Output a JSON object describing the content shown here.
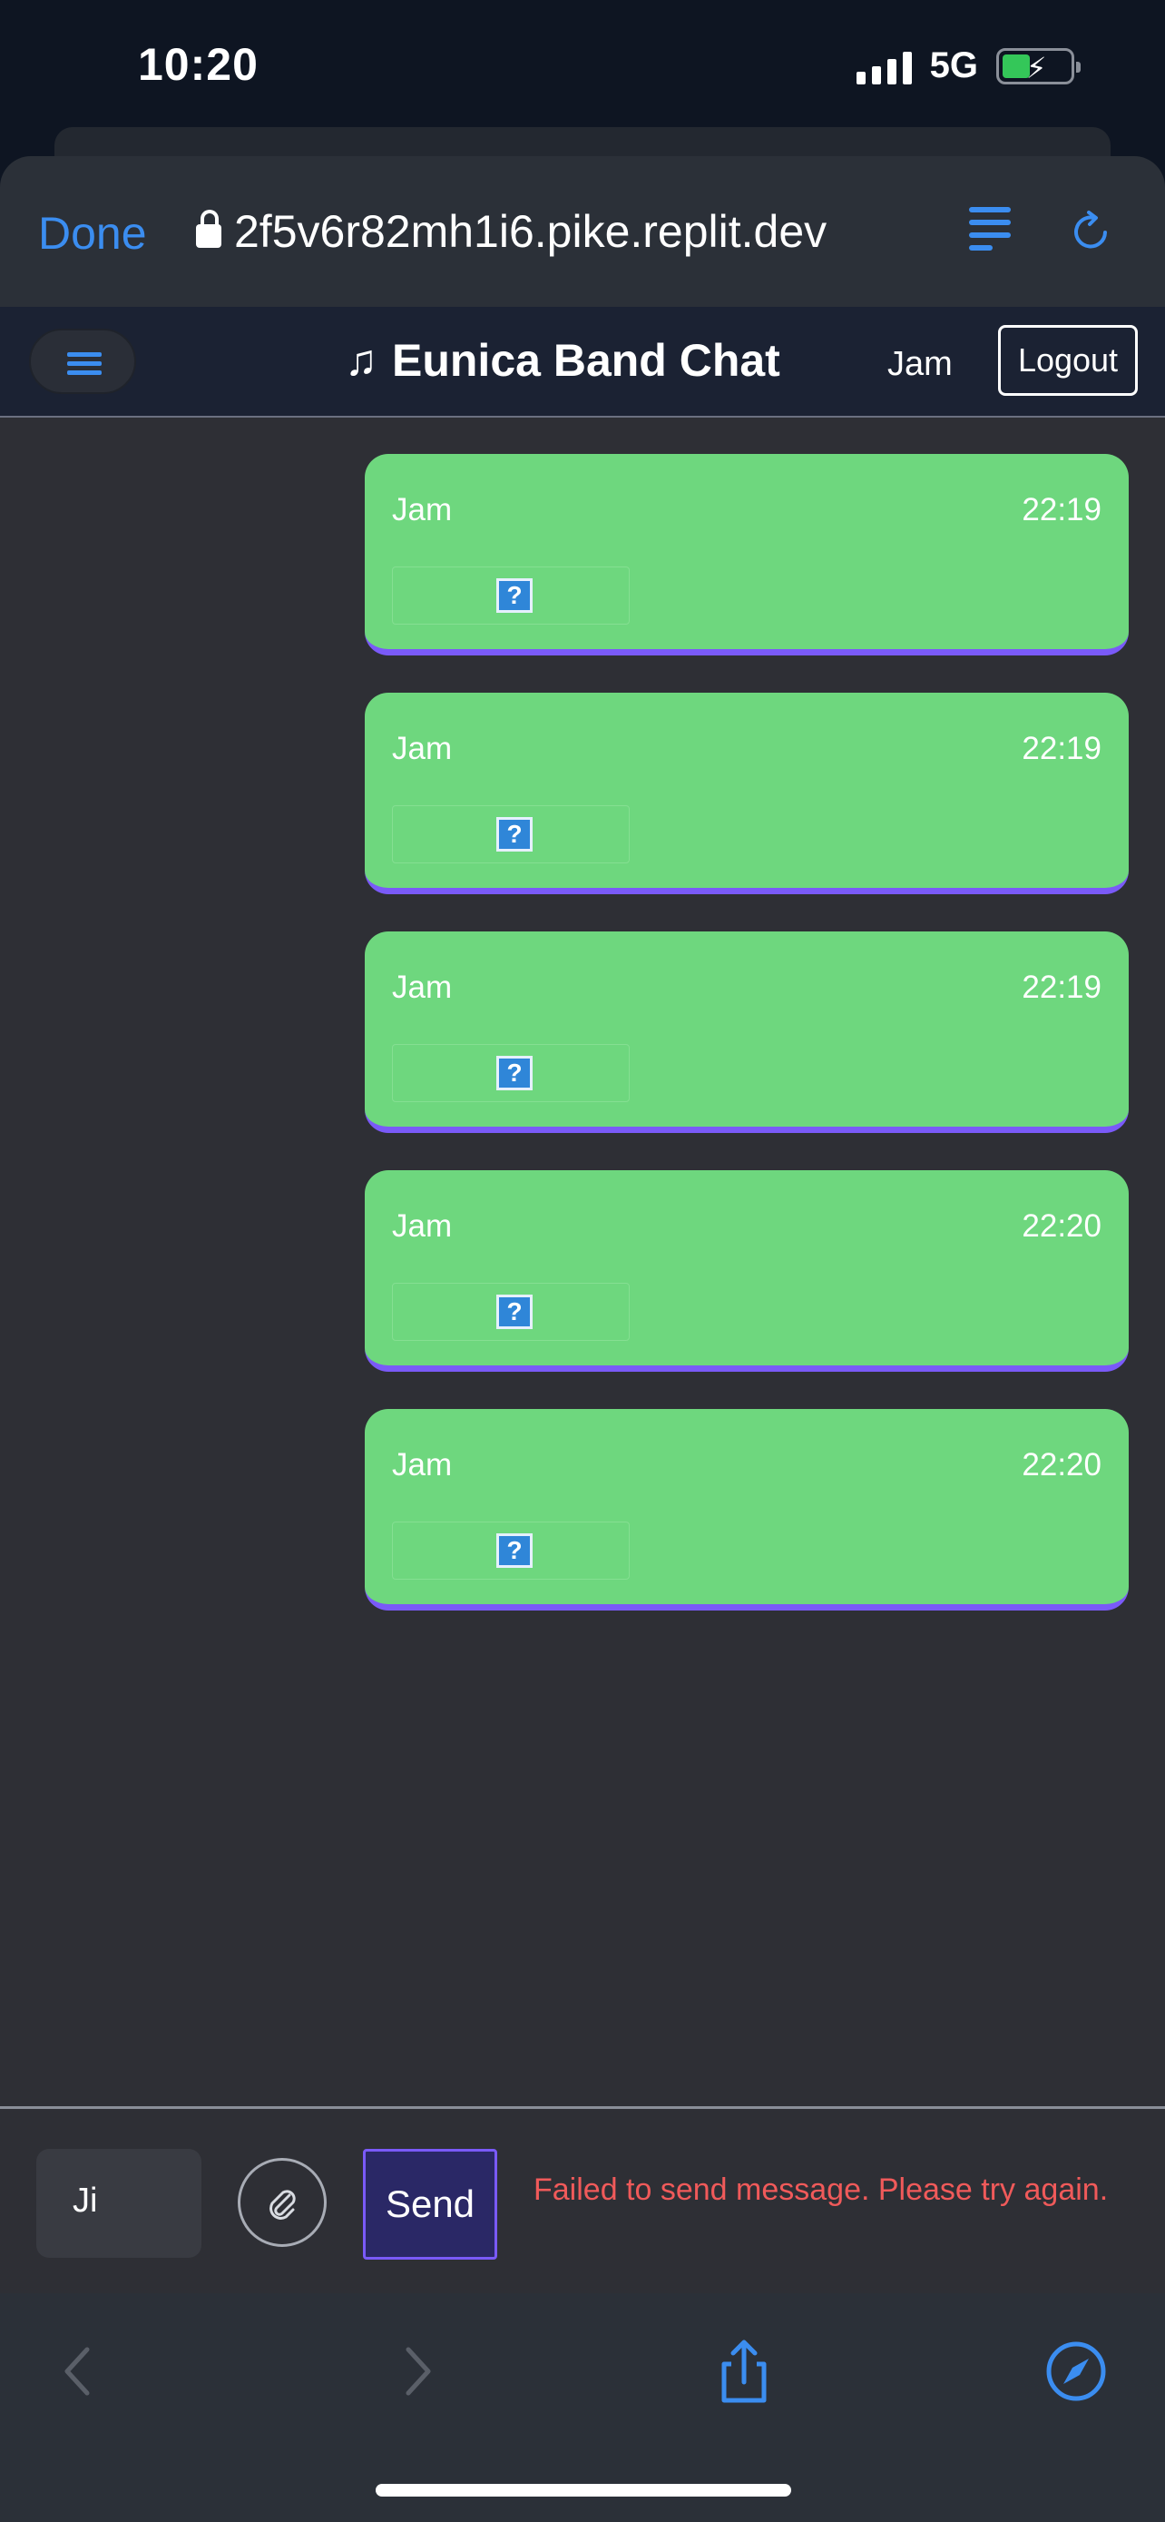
{
  "status_bar": {
    "time": "10:20",
    "network": "5G",
    "icons": [
      "signal-icon",
      "battery-charging-icon"
    ]
  },
  "browser": {
    "done_label": "Done",
    "url": "2f5v6r82mh1i6.pike.replit.dev",
    "icons": [
      "lock-icon",
      "reader-icon",
      "reload-icon"
    ],
    "accent_color": "#3b8df0"
  },
  "app": {
    "title": "Eunica Band Chat",
    "title_icon": "music-note-icon",
    "username": "Jam",
    "logout_label": "Logout",
    "menu_icon": "hamburger-icon"
  },
  "messages": [
    {
      "sender": "Jam",
      "time": "22:19",
      "attachment_icon": "broken-image-icon"
    },
    {
      "sender": "Jam",
      "time": "22:19",
      "attachment_icon": "broken-image-icon"
    },
    {
      "sender": "Jam",
      "time": "22:19",
      "attachment_icon": "broken-image-icon"
    },
    {
      "sender": "Jam",
      "time": "22:20",
      "attachment_icon": "broken-image-icon"
    },
    {
      "sender": "Jam",
      "time": "22:20",
      "attachment_icon": "broken-image-icon"
    }
  ],
  "composer": {
    "input_value": "Ji",
    "attach_icon": "paperclip-icon",
    "send_label": "Send",
    "error_message": "Failed to send message. Please try again.",
    "error_color": "#f05a5a"
  },
  "toolbar": {
    "icons": [
      "back-icon",
      "forward-icon",
      "share-icon",
      "compass-icon"
    ]
  },
  "colors": {
    "message_bubble": "#6ed77e",
    "message_accent": "#7a5af8",
    "app_background": "#2e2f35",
    "header_background": "#1b2233"
  }
}
